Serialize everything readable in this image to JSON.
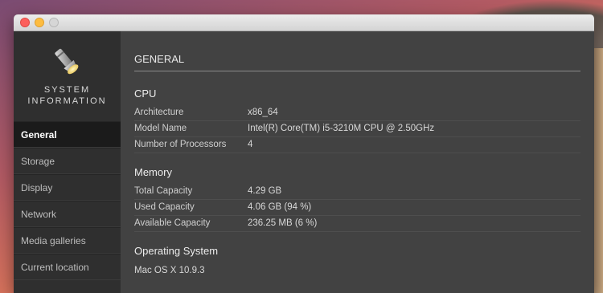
{
  "sidebar": {
    "app_title_line1": "SYSTEM",
    "app_title_line2": "INFORMATION",
    "items": [
      {
        "label": "General"
      },
      {
        "label": "Storage"
      },
      {
        "label": "Display"
      },
      {
        "label": "Network"
      },
      {
        "label": "Media galleries"
      },
      {
        "label": "Current location"
      }
    ]
  },
  "main": {
    "heading": "GENERAL",
    "cpu": {
      "title": "CPU",
      "rows": [
        {
          "label": "Architecture",
          "value": "x86_64"
        },
        {
          "label": "Model Name",
          "value": "Intel(R) Core(TM) i5-3210M CPU @ 2.50GHz"
        },
        {
          "label": "Number of Processors",
          "value": "4"
        }
      ]
    },
    "memory": {
      "title": "Memory",
      "rows": [
        {
          "label": "Total Capacity",
          "value": "4.29 GB"
        },
        {
          "label": "Used Capacity",
          "value": "4.06 GB (94 %)"
        },
        {
          "label": "Available Capacity",
          "value": "236.25 MB (6 %)"
        }
      ]
    },
    "os": {
      "title": "Operating System",
      "value": "Mac OS X 10.9.3"
    }
  }
}
